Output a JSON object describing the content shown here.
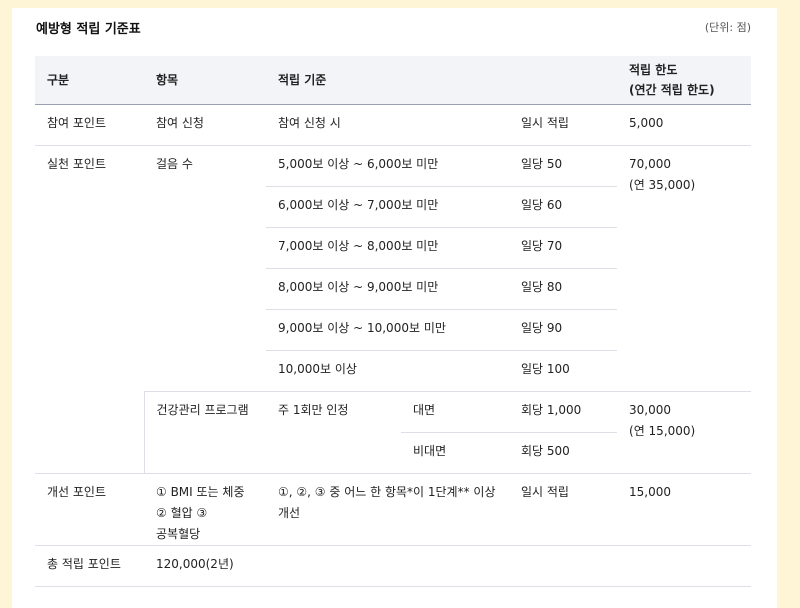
{
  "caption": "예방형 적립 기준표",
  "unit": "(단위: 점)",
  "headers": {
    "category": "구분",
    "item": "항목",
    "criteria": "적립 기준",
    "limit_line1": "적립 한도",
    "limit_line2": "(연간 적립 한도)"
  },
  "participation": {
    "category": "참여 포인트",
    "item": "참여 신청",
    "criteria": "참여 신청 시",
    "points": "일시 적립",
    "limit": "5,000"
  },
  "practice": {
    "category": "실천 포인트",
    "steps": {
      "item": "걸음 수",
      "limit_line1": "70,000",
      "limit_line2": "(연 35,000)",
      "rows": [
        {
          "criteria": "5,000보 이상 ~ 6,000보 미만",
          "points": "일당 50"
        },
        {
          "criteria": "6,000보 이상 ~ 7,000보 미만",
          "points": "일당 60"
        },
        {
          "criteria": "7,000보 이상 ~ 8,000보 미만",
          "points": "일당 70"
        },
        {
          "criteria": "8,000보 이상 ~ 9,000보 미만",
          "points": "일당 80"
        },
        {
          "criteria": "9,000보 이상 ~ 10,000보 미만",
          "points": "일당 90"
        },
        {
          "criteria": "10,000보 이상",
          "points": "일당 100"
        }
      ]
    },
    "program": {
      "item": "건강관리 프로그램",
      "criteria": "주 1회만 인정",
      "limit_line1": "30,000",
      "limit_line2": "(연 15,000)",
      "rows": [
        {
          "type": "대면",
          "points": "회당 1,000"
        },
        {
          "type": "비대면",
          "points": "회당 500"
        }
      ]
    }
  },
  "improvement": {
    "category": "개선 포인트",
    "item": "① BMI 또는 체중 ② 혈압 ③ 공복혈당",
    "criteria": "①, ②, ③ 중 어느 한 항목*이 1단계** 이상 개선",
    "points": "일시 적립",
    "limit": "15,000"
  },
  "total": {
    "label": "총 적립 포인트",
    "value": "120,000(2년)"
  }
}
